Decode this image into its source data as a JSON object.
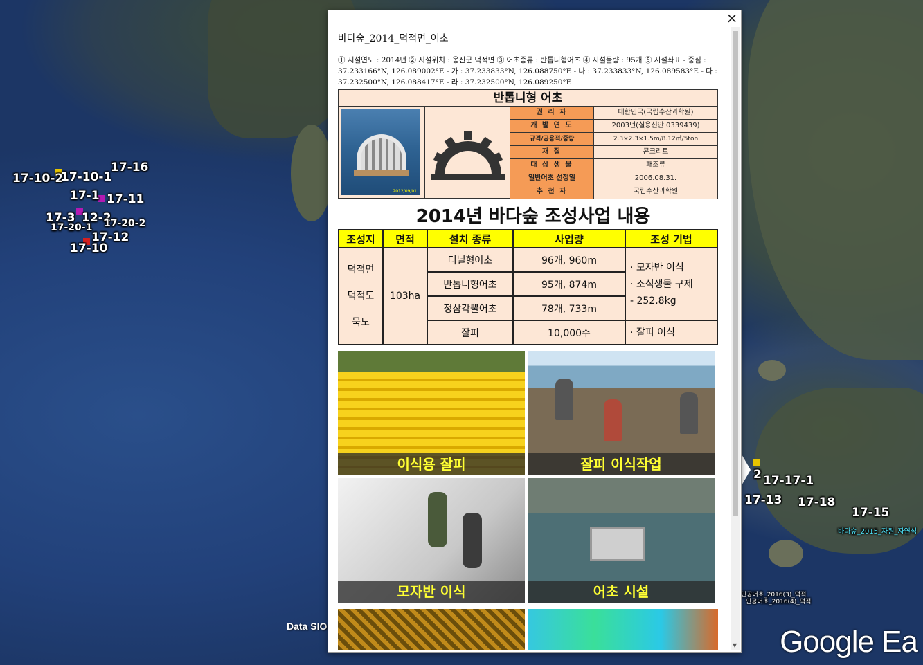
{
  "map": {
    "placemarks_left": [
      "17-16",
      "17-10-2",
      "17-10-1",
      "17-1",
      "17-11",
      "17-3",
      "12-2",
      "17-20-1",
      "17-20-2",
      "17-12",
      "17-10"
    ],
    "placemarks_right": [
      "2",
      "17-17-1",
      "17-13",
      "17-18",
      "17-15"
    ],
    "layer_label_cyan": "바다숲_2015_자원_자연석",
    "layer_label_1": "인공어초_2016(3)_덕적",
    "layer_label_2": "인공어초_2016(4)_덕적",
    "data_text": "Data SIO",
    "watermark": "Google Ea"
  },
  "balloon": {
    "close_label": "×",
    "title": "바다숲_2014_덕적면_어초",
    "description": "① 시설연도 : 2014년 ② 시설위치 : 옹진군 덕적면 ③ 어초종류 : 반톱니형어초 ④ 시설물량 : 95개 ⑤ 시설좌표 - 중심 : 37.233166°N, 126.089002°E - 가 : 37.233833°N, 126.088750°E - 나 : 37.233833°N, 126.089583°E - 다 : 37.232500°N, 126.088417°E - 라 : 37.232500°N, 126.089250°E",
    "card": {
      "title": "반톱니형 어초",
      "photo_date": "2012/09/01",
      "rows": [
        {
          "key": "권 리 자",
          "value": "대한민국(국립수산과학원)"
        },
        {
          "key": "개 발 연 도",
          "value": "2003년(실용신안 0339439)"
        },
        {
          "key": "규격/공용적/중량",
          "value": "2.3×2.3×1.5m/8.12㎥/5ton"
        },
        {
          "key": "재 질",
          "value": "콘크리트"
        },
        {
          "key": "대 상 생 물",
          "value": "패조류"
        },
        {
          "key": "일반어초 선정일",
          "value": "2006.08.31."
        },
        {
          "key": "추 천 자",
          "value": "국립수산과학원"
        }
      ]
    },
    "project": {
      "title": "2014년 바다숲 조성사업 내용",
      "headers": [
        "조성지",
        "면적",
        "설치 종류",
        "사업량",
        "조성 기법"
      ],
      "site": [
        "덕적면",
        "덕적도",
        "묵도"
      ],
      "area": "103ha",
      "items": [
        {
          "type": "터널형어초",
          "amount": "96개, 960m"
        },
        {
          "type": "반톱니형어초",
          "amount": "95개, 874m"
        },
        {
          "type": "정삼각뿔어초",
          "amount": "78개, 733m"
        },
        {
          "type": "잘피",
          "amount": "10,000주"
        }
      ],
      "method_1": "· 모자반 이식",
      "method_2": "· 조식생물 구제",
      "method_3": "- 252.8kg",
      "method_4": "· 잘피 이식"
    },
    "photos": [
      "이식용 잘피",
      "잘피 이식작업",
      "모자반 이식",
      "어초 시설"
    ]
  }
}
